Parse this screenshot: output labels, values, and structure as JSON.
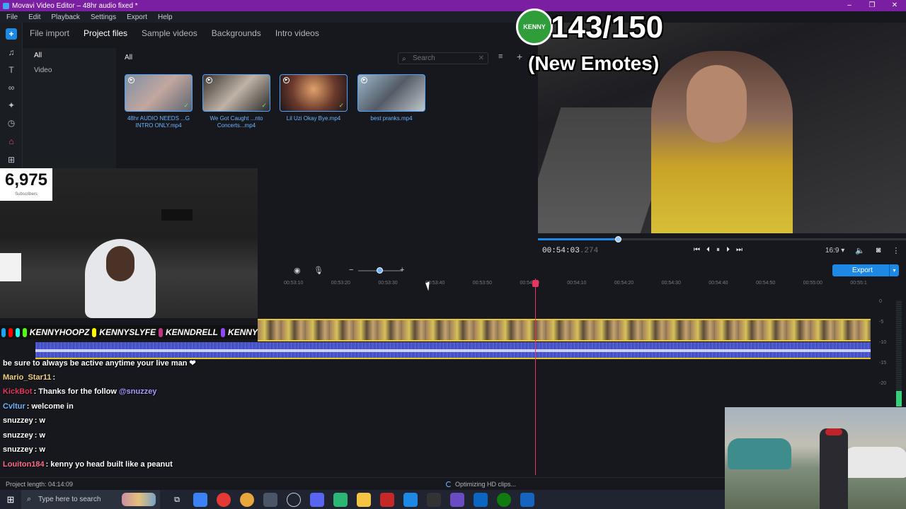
{
  "window": {
    "title": "Movavi Video Editor – 48hr audio fixed *",
    "controls": [
      "–",
      "❐",
      "✕"
    ]
  },
  "menu": [
    "File",
    "Edit",
    "Playback",
    "Settings",
    "Export",
    "Help"
  ],
  "import_tabs": {
    "items": [
      "File import",
      "Project files",
      "Sample videos",
      "Backgrounds",
      "Intro videos"
    ],
    "selected": "Project files"
  },
  "categories": {
    "items": [
      "All",
      "Video"
    ],
    "selected": "All"
  },
  "files": {
    "heading": "All",
    "search_placeholder": "Search",
    "items": [
      {
        "name": "48hr AUDIO NEEDS ...G INTRO ONLY.mp4"
      },
      {
        "name": "We Got Caught ...nto Concerts...mp4"
      },
      {
        "name": "Lil Uzi Okay Bye.mp4"
      },
      {
        "name": "best pranks.mp4"
      }
    ]
  },
  "overlay": {
    "count": "143/150",
    "subtitle": "(New Emotes)",
    "logo_text": "KENNY"
  },
  "subscribers": {
    "count": "6,975",
    "label": "Subscribers"
  },
  "socials": [
    "KENNYHOOPZ",
    "KENNYSLYFE",
    "KENNDRELL",
    "KENNY"
  ],
  "player": {
    "timecode": "00:54:03",
    "timecode_ms": ".274",
    "progress": 0.217,
    "aspect": "16:9 ▾",
    "controls": [
      "⏮",
      "⏴",
      "⏸",
      "⏵",
      "⏭"
    ]
  },
  "export_label": "Export",
  "ruler_ticks": [
    "00:53:10",
    "00:53:20",
    "00:53:30",
    "00:53:40",
    "00:53:50",
    "00:54:00",
    "00:54:10",
    "00:54:20",
    "00:54:30",
    "00:54:40",
    "00:54:50",
    "00:55:00",
    "00:55:1"
  ],
  "meter_labels": [
    "0",
    "-5",
    "-10",
    "-15",
    "-20"
  ],
  "chat": [
    {
      "user": "",
      "text": "be sure to always be active anytime your live man ❤",
      "color": "#ffffff"
    },
    {
      "user": "Mario_Star11",
      "text": ":",
      "color": "#f2d17a"
    },
    {
      "user": "KickBot",
      "text": ": Thanks for the follow ",
      "mention": "@snuzzey",
      "color": "#e5365e"
    },
    {
      "user": "Cvltur",
      "text": ": welcome in",
      "color": "#6fb6ff"
    },
    {
      "user": "snuzzey",
      "text": ": w",
      "color": "#ffffff"
    },
    {
      "user": "snuzzey",
      "text": ": w",
      "color": "#ffffff"
    },
    {
      "user": "snuzzey",
      "text": ": w",
      "color": "#ffffff"
    },
    {
      "user": "Louiton184",
      "text": ": kenny yo head built like a peanut",
      "color": "#ff6b8a"
    }
  ],
  "status": {
    "project_length": "Project length: 04:14:09",
    "optimizing": "Optimizing HD clips..."
  },
  "taskbar": {
    "search_placeholder": "Type here to search"
  }
}
